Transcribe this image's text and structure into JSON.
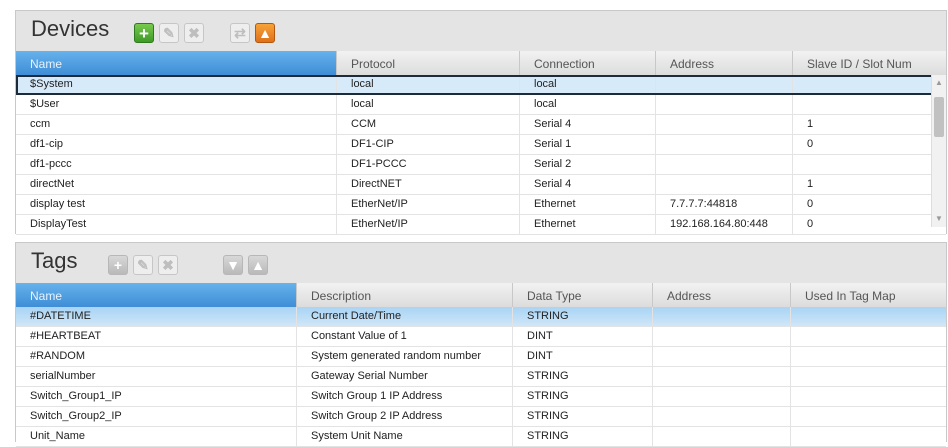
{
  "devices": {
    "title": "Devices",
    "columns": [
      "Name",
      "Protocol",
      "Connection",
      "Address",
      "Slave ID / Slot Num"
    ],
    "rows": [
      [
        "$System",
        "local",
        "local",
        "",
        ""
      ],
      [
        "$User",
        "local",
        "local",
        "",
        ""
      ],
      [
        "ccm",
        "CCM",
        "Serial 4",
        "",
        "1"
      ],
      [
        "df1-cip",
        "DF1-CIP",
        "Serial 1",
        "",
        "0"
      ],
      [
        "df1-pccc",
        "DF1-PCCC",
        "Serial 2",
        "",
        ""
      ],
      [
        "directNet",
        "DirectNET",
        "Serial 4",
        "",
        "1"
      ],
      [
        "display test",
        "EtherNet/IP",
        "Ethernet",
        "7.7.7.7:44818",
        "0"
      ],
      [
        "DisplayTest",
        "EtherNet/IP",
        "Ethernet",
        "192.168.164.80:448",
        "0"
      ]
    ],
    "selected_row": 0
  },
  "tags": {
    "title": "Tags",
    "columns": [
      "Name",
      "Description",
      "Data Type",
      "Address",
      "Used In Tag Map"
    ],
    "rows": [
      [
        "#DATETIME",
        "Current Date/Time",
        "STRING",
        "",
        ""
      ],
      [
        "#HEARTBEAT",
        "Constant Value of 1",
        "DINT",
        "",
        ""
      ],
      [
        "#RANDOM",
        "System generated random number",
        "DINT",
        "",
        ""
      ],
      [
        "serialNumber",
        "Gateway Serial Number",
        "STRING",
        "",
        ""
      ],
      [
        "Switch_Group1_IP",
        "Switch Group 1 IP Address",
        "STRING",
        "",
        ""
      ],
      [
        "Switch_Group2_IP",
        "Switch Group 2 IP Address",
        "STRING",
        "",
        ""
      ],
      [
        "Unit_Name",
        "System Unit Name",
        "STRING",
        "",
        ""
      ]
    ],
    "selected_row": 0
  },
  "icons": {
    "add": "plus-icon",
    "edit": "pencil-icon",
    "delete": "x-icon",
    "link": "link-icon",
    "move_down": "arrow-down-icon",
    "move_up": "arrow-up-icon"
  },
  "colors": {
    "header_blue": "#3f8dd6",
    "selected_row": "#d7eafa",
    "add_green": "#3e9a26",
    "up_orange": "#e0701a"
  }
}
